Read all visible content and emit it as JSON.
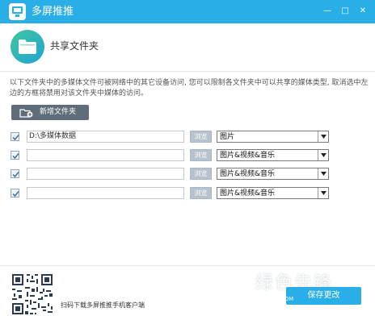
{
  "window": {
    "title": "多屏推推",
    "minimize_glyph": "—",
    "maximize_glyph": "□",
    "close_glyph": "✕"
  },
  "header": {
    "icon": "folder-icon",
    "title": "共享文件夹"
  },
  "description": "以下文件夹中的多媒体文件可被网络中的其它设备访问, 您可以限制各文件夹中可以共享的媒体类型, 取消选中左边的方框将禁用对该文件夹中媒体的访问。",
  "add_button": {
    "label": "新增文件夹",
    "icon": "add-folder-icon"
  },
  "folders": [
    {
      "checked": true,
      "path": "D:\\多媒体数据",
      "browse_label": "浏览",
      "media_type": "图片"
    },
    {
      "checked": true,
      "path": "",
      "browse_label": "浏览",
      "media_type": "图片&视频&音乐"
    },
    {
      "checked": true,
      "path": "",
      "browse_label": "浏览",
      "media_type": "图片&视频&音乐"
    },
    {
      "checked": true,
      "path": "",
      "browse_label": "浏览",
      "media_type": "图片&视频&音乐"
    }
  ],
  "footer": {
    "qr_caption": "扫码下载多屏推推手机客户端",
    "save_label": "保存更改",
    "watermark": "绿色先锋",
    "watermark_sub": "GDOWN.COM"
  },
  "colors": {
    "accent": "#2aaee8",
    "button_dark": "#5f6d7a",
    "browse_button": "#b6c2cc"
  }
}
